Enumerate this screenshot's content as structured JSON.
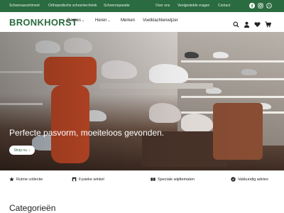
{
  "topbar": {
    "links": [
      "Schoenassortiment",
      "Orthopedische schoentechniek",
      "Schoenreparatie",
      "Over ons",
      "Veelgestelde vragen",
      "Contact"
    ],
    "social": [
      "facebook-icon",
      "instagram-icon",
      "whatsapp-icon"
    ]
  },
  "header": {
    "logo": "BRONKHORST",
    "nav": [
      "Dames",
      "Heren",
      "Merken",
      "Voetklachtenwijzer"
    ],
    "icons": [
      "search-icon",
      "account-icon",
      "wishlist-icon",
      "cart-icon"
    ]
  },
  "hero": {
    "title": "Perfecte pasvorm, moeiteloos gevonden.",
    "button": "Shop nu"
  },
  "usps": [
    "Ruime collectie",
    "Fysieke winkel",
    "Speciale wijdtematen",
    "Vakkundig advies"
  ],
  "section_title": "Categorieën",
  "colors": {
    "brand_green": "#2a6b3f",
    "accent_orange": "#d4502a"
  }
}
